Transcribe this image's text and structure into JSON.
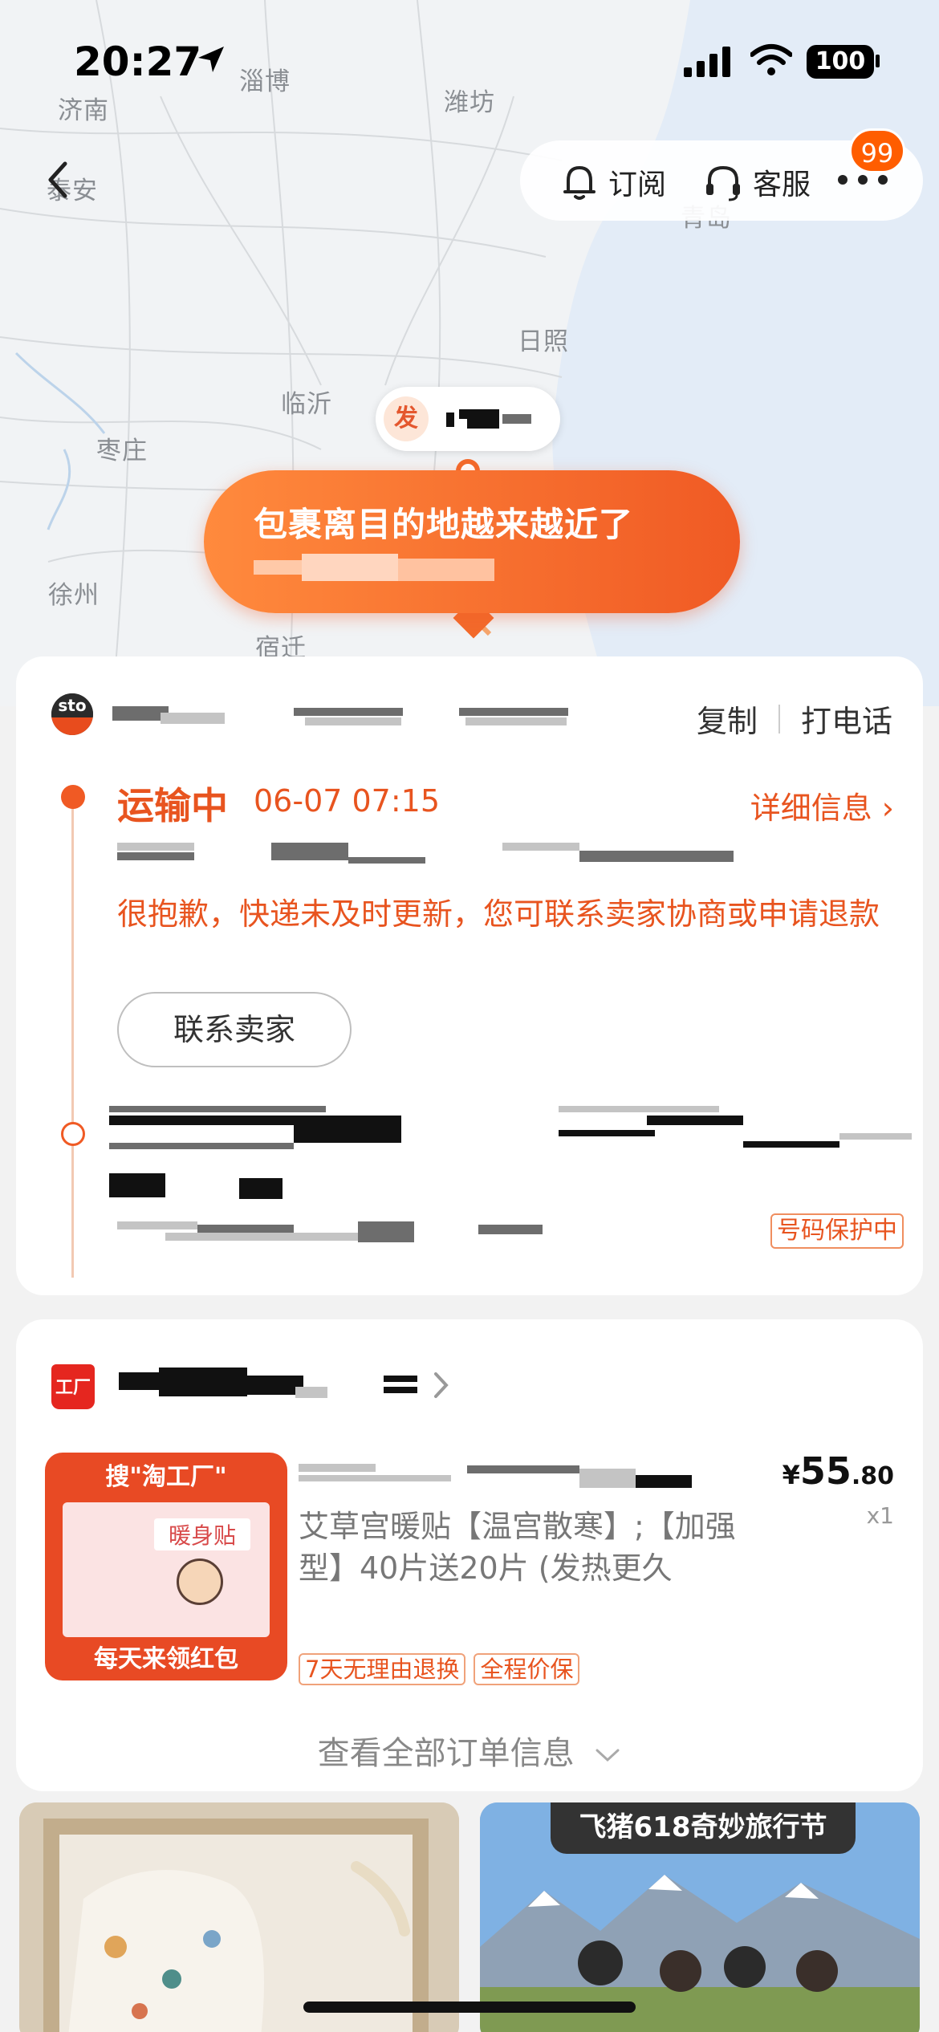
{
  "status_bar": {
    "time": "20:27",
    "battery": "100"
  },
  "map": {
    "cities": [
      "济南",
      "淄博",
      "潍坊",
      "泰安",
      "青岛",
      "日照",
      "临沂",
      "枣庄",
      "徐州",
      "宿迁"
    ]
  },
  "top_actions": {
    "subscribe": "订阅",
    "service": "客服",
    "badge": "99"
  },
  "sender_pin": {
    "label": "发"
  },
  "bubble": {
    "title": "包裹离目的地越来越近了"
  },
  "tracking": {
    "courier_logo": "sto",
    "copy": "复制",
    "call": "打电话",
    "status": "运输中",
    "status_time": "06-07 07:15",
    "detail_link": "详细信息 ›",
    "apology": "很抱歉，快递未及时更新，您可联系卖家协商或申请退款",
    "contact_seller": "联系卖家",
    "number_protected": "号码保护中"
  },
  "order": {
    "shop_icon_text": "工厂",
    "product_title": "艾草宫暖贴【温宫散寒】;【加强型】40片送20片 (发热更久",
    "price_currency": "¥",
    "price_int": "55",
    "price_dec": ".80",
    "quantity": "x1",
    "tags": [
      "7天无理由退换",
      "全程价保"
    ],
    "view_all": "查看全部订单信息",
    "product_image": {
      "top_text": "搜\"淘工厂\"",
      "box_label": "暖身贴",
      "bottom_text": "每天来领红包"
    }
  },
  "recommend": {
    "right_banner": "飞猪618奇妙旅行节"
  },
  "colors": {
    "accent": "#f05a24",
    "badge": "#ff5d00"
  }
}
